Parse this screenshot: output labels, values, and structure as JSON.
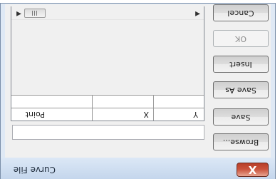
{
  "window": {
    "title": "Curve File",
    "close_glyph": "X"
  },
  "buttons": {
    "browse": "Browse...",
    "save": "Save",
    "save_as": "Save As",
    "insert": "Insert",
    "ok": "OK",
    "cancel": "Cancel"
  },
  "file_path": {
    "value": ""
  },
  "table": {
    "columns": [
      "Point",
      "X",
      "Y"
    ],
    "rows": []
  },
  "icons": {
    "close": "close-icon",
    "scroll_left": "scroll-left-arrow-icon",
    "scroll_right": "scroll-right-arrow-icon"
  },
  "colors": {
    "close_button": "#c9513a",
    "title_bar": "#c4d6ec",
    "client": "#f0f0f0"
  }
}
